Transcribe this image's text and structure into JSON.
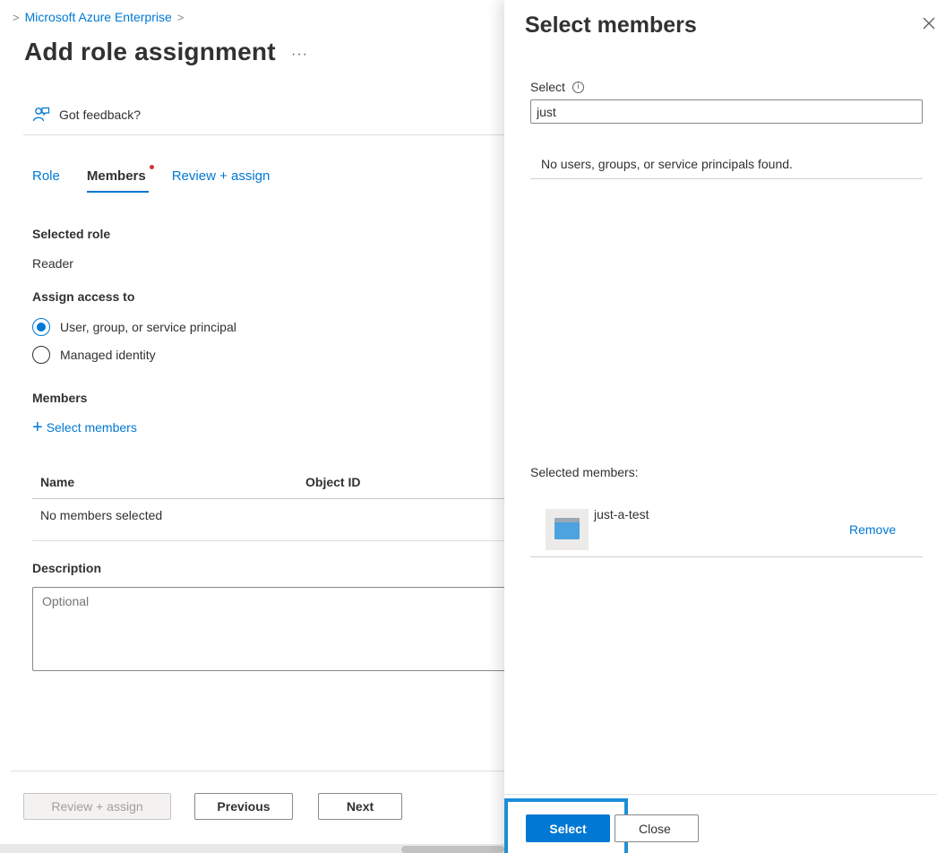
{
  "breadcrumb": {
    "prefix": ">",
    "item": "Microsoft Azure Enterprise",
    "separator": ">"
  },
  "page": {
    "title": "Add role assignment",
    "more": "···"
  },
  "feedback": {
    "label": "Got feedback?"
  },
  "tabs": [
    {
      "label": "Role"
    },
    {
      "label": "Members"
    },
    {
      "label": "Review + assign"
    }
  ],
  "role": {
    "heading": "Selected role",
    "value": "Reader"
  },
  "assign_access": {
    "heading": "Assign access to",
    "options": [
      {
        "label": "User, group, or service principal",
        "selected": true
      },
      {
        "label": "Managed identity",
        "selected": false
      }
    ]
  },
  "members": {
    "heading": "Members",
    "add_link": "Select members",
    "columns": [
      "Name",
      "Object ID"
    ],
    "empty_text": "No members selected"
  },
  "description": {
    "heading": "Description",
    "placeholder": "Optional"
  },
  "footer": {
    "review_assign": "Review + assign",
    "previous": "Previous",
    "next": "Next"
  },
  "panel": {
    "title": "Select members",
    "select_label": "Select",
    "search_value": "just",
    "no_results": "No users, groups, or service principals found.",
    "selected_label": "Selected members:",
    "selected_items": [
      {
        "name": "just-a-test",
        "remove": "Remove"
      }
    ],
    "select_button": "Select",
    "close_button": "Close"
  },
  "colors": {
    "accent": "#0078d4",
    "highlight": "#1b8fd6",
    "required_dot": "#d13438"
  }
}
